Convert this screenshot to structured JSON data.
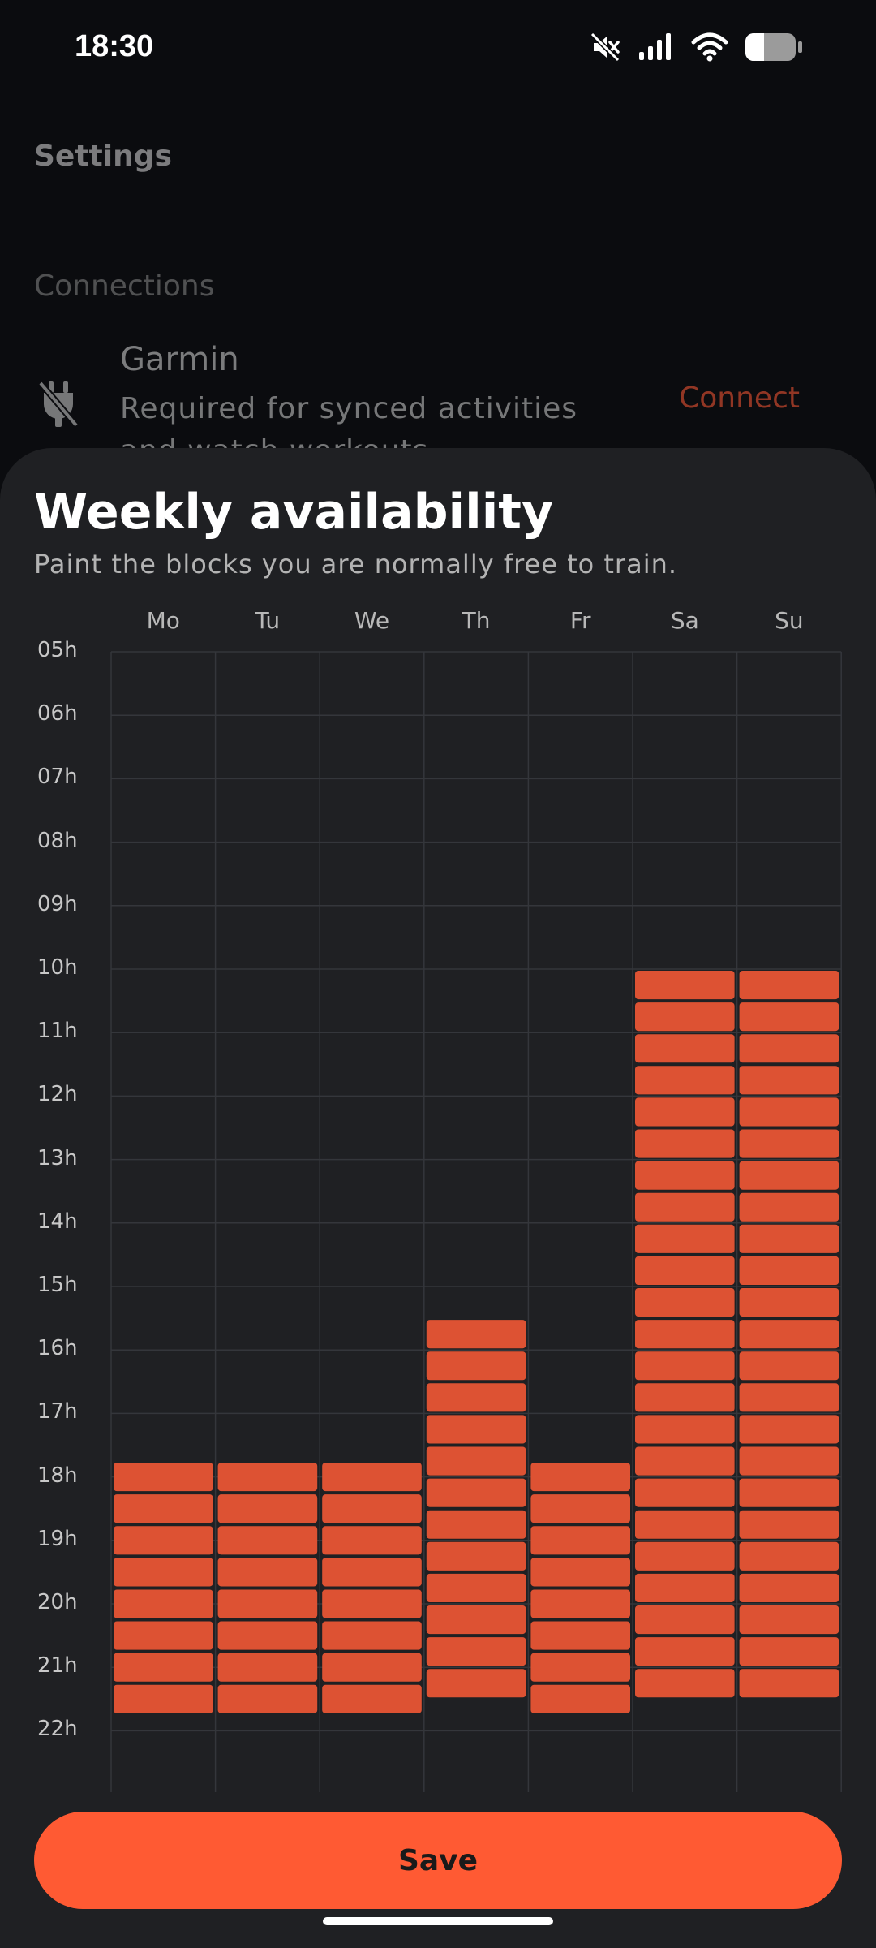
{
  "status_bar": {
    "time": "18:30",
    "icons": [
      "mute-icon",
      "signal-icon",
      "wifi-icon",
      "battery-icon"
    ]
  },
  "background_page": {
    "title": "Settings",
    "section_label": "Connections",
    "garmin": {
      "title": "Garmin",
      "description": "Required for synced activities and watch workouts",
      "action": "Connect",
      "icon": "plug-off-icon"
    }
  },
  "sheet": {
    "title": "Weekly availability",
    "subtitle": "Paint the blocks you are normally free to train.",
    "days": [
      "Mo",
      "Tu",
      "We",
      "Th",
      "Fr",
      "Sa",
      "Su"
    ],
    "hours": [
      "05h",
      "06h",
      "07h",
      "08h",
      "09h",
      "10h",
      "11h",
      "12h",
      "13h",
      "14h",
      "15h",
      "16h",
      "17h",
      "18h",
      "19h",
      "20h",
      "21h",
      "22h"
    ],
    "availability": {
      "Mo": [
        [
          17.75,
          21.5
        ]
      ],
      "Tu": [
        [
          17.75,
          21.5
        ]
      ],
      "We": [
        [
          17.75,
          21.5
        ]
      ],
      "Th": [
        [
          15.5,
          21.5
        ]
      ],
      "Fr": [
        [
          17.75,
          21.5
        ]
      ],
      "Sa": [
        [
          10.0,
          21.5
        ]
      ],
      "Su": [
        [
          10.0,
          21.5
        ]
      ]
    },
    "save_label": "Save"
  },
  "colors": {
    "accent": "#ff5a33",
    "block": "#dd5233",
    "sheet_bg": "#1f2023",
    "grid_line": "#34363b"
  }
}
